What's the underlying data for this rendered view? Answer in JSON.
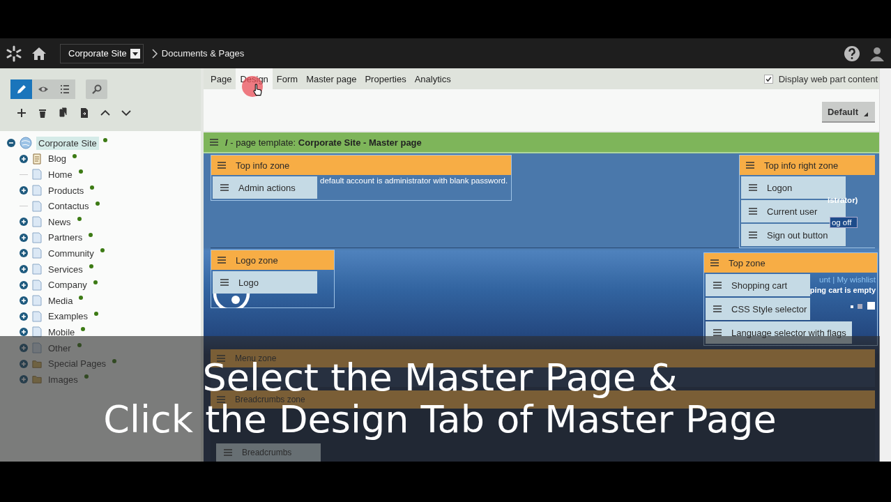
{
  "header": {
    "site": "Corporate Site",
    "breadcrumb": "Documents & Pages"
  },
  "view_modes": [
    {
      "kind": "edit",
      "selected": true
    },
    {
      "kind": "preview",
      "selected": false
    },
    {
      "kind": "list",
      "selected": false
    }
  ],
  "tabs": [
    {
      "label": "Page",
      "selected": false
    },
    {
      "label": "Design",
      "selected": true
    },
    {
      "label": "Form",
      "selected": false
    },
    {
      "label": "Master page",
      "selected": false
    },
    {
      "label": "Properties",
      "selected": false
    },
    {
      "label": "Analytics",
      "selected": false
    }
  ],
  "display_web_part_content": {
    "label": "Display web part content",
    "checked": true
  },
  "layout_button": "Default",
  "tree": {
    "label": "Corporate Site",
    "kind": "globe",
    "expanded": true,
    "selected": true,
    "children": [
      {
        "label": "Blog",
        "kind": "blog",
        "expandable": true
      },
      {
        "label": "Home",
        "kind": "page",
        "expandable": false
      },
      {
        "label": "Products",
        "kind": "page",
        "expandable": true
      },
      {
        "label": "Contactus",
        "kind": "page",
        "expandable": false
      },
      {
        "label": "News",
        "kind": "page",
        "expandable": true
      },
      {
        "label": "Partners",
        "kind": "page",
        "expandable": true
      },
      {
        "label": "Community",
        "kind": "page",
        "expandable": true
      },
      {
        "label": "Services",
        "kind": "page",
        "expandable": true
      },
      {
        "label": "Company",
        "kind": "page",
        "expandable": true
      },
      {
        "label": "Media",
        "kind": "page",
        "expandable": true
      },
      {
        "label": "Examples",
        "kind": "page",
        "expandable": true
      },
      {
        "label": "Mobile",
        "kind": "page",
        "expandable": true
      },
      {
        "label": "Other",
        "kind": "page",
        "expandable": true
      },
      {
        "label": "Special Pages",
        "kind": "folder",
        "expandable": true
      },
      {
        "label": "Images",
        "kind": "folder",
        "expandable": true
      }
    ]
  },
  "template_bar": "**/** - page template: **Corporate Site - Master page**",
  "top_info_zone": {
    "title": "Top info zone",
    "webparts": [
      "Admin actions"
    ],
    "content": "default account is administrator with blank password."
  },
  "top_info_right_zone": {
    "title": "Top info right zone",
    "webparts": [
      "Logon",
      "Current user",
      "Sign out button"
    ],
    "content": [
      "istrator)",
      "og off"
    ]
  },
  "logo_zone": {
    "title": "Logo zone",
    "webparts": [
      "Logo"
    ]
  },
  "top_zone": {
    "title": "Top zone",
    "webparts": [
      "Shopping cart",
      "CSS Style selector",
      "Language selector with flags"
    ],
    "content": [
      "unt | My wishlist",
      "ping cart is empty"
    ]
  },
  "menu_zone": {
    "title": "Menu zone"
  },
  "breadcrumbs_zone": {
    "title": "Breadcrumbs zone",
    "webparts": [
      "Breadcrumbs"
    ]
  },
  "caption": [
    "Select the Master Page &",
    "Click the Design Tab of Master Page"
  ]
}
